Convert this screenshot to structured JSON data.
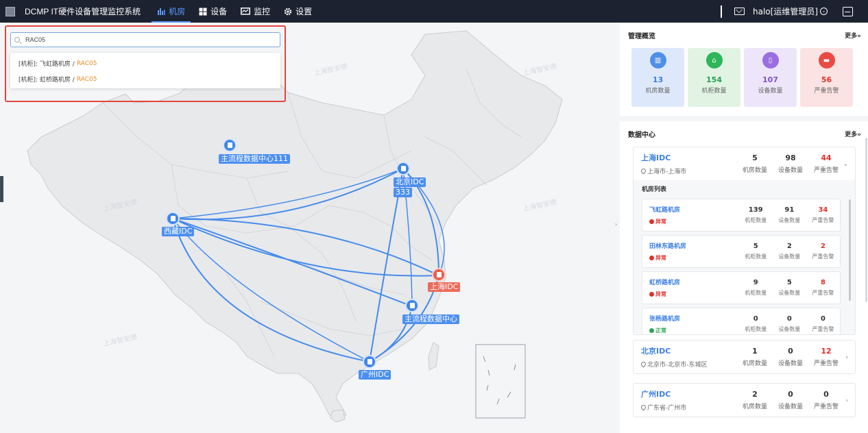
{
  "header": {
    "app_title": "DCMP IT硬件设备管理监控系统",
    "nav": [
      {
        "label": "机房",
        "icon": "bar-chart-icon",
        "active": true
      },
      {
        "label": "设备",
        "icon": "grid-icon",
        "active": false
      },
      {
        "label": "监控",
        "icon": "monitor-icon",
        "active": false
      },
      {
        "label": "设置",
        "icon": "gear-icon",
        "active": false
      }
    ],
    "user": "halo[运维管理员]"
  },
  "search": {
    "value": "RAC05",
    "results": [
      {
        "prefix": "[机柜]: 飞虹路机房 /",
        "match": "RAC05"
      },
      {
        "prefix": "[机柜]: 虹桥路机房 /",
        "match": "RAC05"
      }
    ]
  },
  "map": {
    "watermark": "上海智安德",
    "nodes": [
      {
        "label": "主流程数据中心111",
        "status": "normal"
      },
      {
        "label": "北京IDC",
        "sublabel": "333",
        "status": "normal"
      },
      {
        "label": "西藏IDC",
        "status": "normal"
      },
      {
        "label": "上海IDC",
        "status": "alarm"
      },
      {
        "label": "主流程数据中心",
        "status": "normal"
      },
      {
        "label": "广州IDC",
        "status": "normal"
      }
    ]
  },
  "overview": {
    "title": "管理概览",
    "more": "更多»",
    "cards": [
      {
        "value": "13",
        "label": "机房数量",
        "bg": "#dde9fb",
        "icon_bg": "#4f8fe8",
        "value_color": "#3d7fe0",
        "icon": "building-icon"
      },
      {
        "value": "154",
        "label": "机柜数量",
        "bg": "#e1f4e4",
        "icon_bg": "#2fb55a",
        "value_color": "#2a9e4c",
        "icon": "home-icon"
      },
      {
        "value": "107",
        "label": "设备数量",
        "bg": "#ede6fa",
        "icon_bg": "#9a6ee0",
        "value_color": "#7d4fd0",
        "icon": "server-icon"
      },
      {
        "value": "56",
        "label": "严重告警",
        "bg": "#fbe3e3",
        "icon_bg": "#ea4a44",
        "value_color": "#d9362f",
        "icon": "alarm-icon"
      }
    ]
  },
  "datacenter": {
    "title": "数据中心",
    "more": "更多»",
    "stat_labels": {
      "rooms": "机房数量",
      "devices": "设备数量",
      "alarms": "严重告警"
    },
    "centers": [
      {
        "name": "上海IDC",
        "location": "上海市-上海市",
        "rooms": "5",
        "devices": "98",
        "alarms": "44",
        "expanded": true
      },
      {
        "name": "北京IDC",
        "location": "北京市-北京市-东城区",
        "rooms": "1",
        "devices": "0",
        "alarms": "12",
        "expanded": false
      },
      {
        "name": "广州IDC",
        "location": "广东省-广州市",
        "rooms": "2",
        "devices": "0",
        "alarms": "0",
        "expanded": false
      }
    ],
    "room_list_title": "机房列表",
    "room_stat_labels": {
      "racks": "机柜数量",
      "devices": "设备数量",
      "alarms": "严重告警"
    },
    "rooms": [
      {
        "name": "飞虹路机房",
        "status": "异常",
        "racks": "139",
        "devices": "91",
        "alarms": "34"
      },
      {
        "name": "田林东路机房",
        "status": "异常",
        "racks": "5",
        "devices": "2",
        "alarms": "2"
      },
      {
        "name": "虹桥路机房",
        "status": "异常",
        "racks": "9",
        "devices": "5",
        "alarms": "8"
      },
      {
        "name": "张杨路机房",
        "status": "正常",
        "racks": "0",
        "devices": "0",
        "alarms": "0"
      }
    ]
  }
}
